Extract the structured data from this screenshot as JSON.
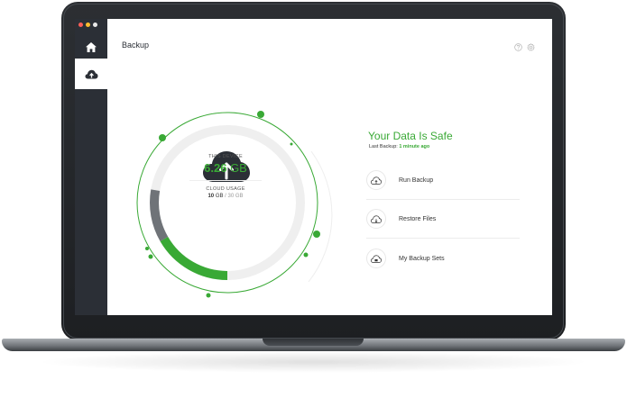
{
  "window": {
    "title": "Backup"
  },
  "sidebar": {
    "items": [
      {
        "icon": "home-icon",
        "active": false
      },
      {
        "icon": "cloud-upload-icon",
        "active": true
      }
    ],
    "traffic_lights": [
      "#ff5f57",
      "#ffbd2e",
      "#ffffff"
    ]
  },
  "header": {
    "icons": [
      "help-icon",
      "gear-icon"
    ]
  },
  "dial": {
    "device_label": "THIS DEVICE",
    "device_value": "6.26",
    "device_unit": "GB",
    "cloud_label": "CLOUD USAGE",
    "cloud_used": "10",
    "cloud_unit_used": "GB",
    "cloud_sep": "/",
    "cloud_total": "30 GB"
  },
  "status": {
    "title": "Your Data Is Safe",
    "last_label": "Last Backup:",
    "last_value": "1 minute ago"
  },
  "actions": [
    {
      "label": "Run Backup",
      "icon": "cloud-upload-icon"
    },
    {
      "label": "Restore Files",
      "icon": "cloud-download-icon"
    },
    {
      "label": "My Backup Sets",
      "icon": "cloud-folder-icon"
    }
  ],
  "colors": {
    "accent": "#39a935",
    "sidebar": "#2b2f36",
    "text": "#333333"
  }
}
